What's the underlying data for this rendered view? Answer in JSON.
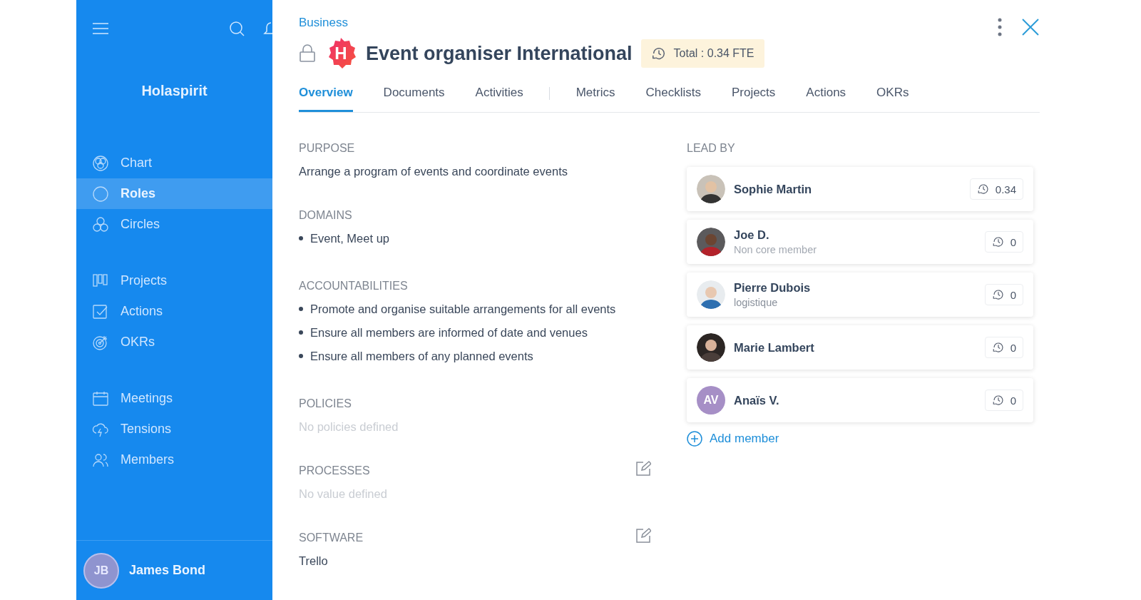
{
  "sidebar": {
    "brand": "Holaspirit",
    "nav_groups": [
      [
        {
          "label": "Chart",
          "selected": false
        },
        {
          "label": "Roles",
          "selected": true
        },
        {
          "label": "Circles",
          "selected": false
        }
      ],
      [
        {
          "label": "Projects",
          "selected": false
        },
        {
          "label": "Actions",
          "selected": false
        },
        {
          "label": "OKRs",
          "selected": false
        }
      ],
      [
        {
          "label": "Meetings",
          "selected": false
        },
        {
          "label": "Tensions",
          "selected": false
        },
        {
          "label": "Members",
          "selected": false
        }
      ]
    ],
    "user": {
      "initials": "JB",
      "name": "James Bond"
    }
  },
  "header": {
    "breadcrumb": "Business",
    "logo_letter": "H",
    "title": "Event organiser International",
    "badge": "Total : 0.34 FTE"
  },
  "tab_groups": [
    [
      {
        "label": "Overview",
        "selected": true
      },
      {
        "label": "Documents",
        "selected": false
      },
      {
        "label": "Activities",
        "selected": false
      }
    ],
    [
      {
        "label": "Metrics",
        "selected": false
      },
      {
        "label": "Checklists",
        "selected": false
      },
      {
        "label": "Projects",
        "selected": false
      },
      {
        "label": "Actions",
        "selected": false
      },
      {
        "label": "OKRs",
        "selected": false
      }
    ]
  ],
  "sections": [
    {
      "title": "PURPOSE",
      "kind": "text",
      "text": "Arrange a program of events and coordinate events",
      "editable": false
    },
    {
      "title": "DOMAINS",
      "kind": "bullets",
      "items": [
        "Event, Meet up"
      ],
      "editable": false
    },
    {
      "title": "ACCOUNTABILITIES",
      "kind": "bullets",
      "items": [
        "Promote and organise suitable arrangements for all events",
        "Ensure all members are informed of date and venues",
        "Ensure all members of any planned events"
      ],
      "editable": false
    },
    {
      "title": "POLICIES",
      "kind": "empty",
      "text": "No policies defined",
      "editable": false
    },
    {
      "title": "PROCESSES",
      "kind": "empty",
      "text": "No value defined",
      "editable": true
    },
    {
      "title": "SOFTWARE",
      "kind": "text",
      "text": "Trello",
      "editable": true
    }
  ],
  "lead_by": {
    "title": "LEAD BY",
    "members": [
      {
        "name": "Sophie Martin",
        "fte": "0.34"
      },
      {
        "name": "Joe D.",
        "subtitle": "Non core member",
        "subtitle_muted": true,
        "fte": "0"
      },
      {
        "name": "Pierre Dubois",
        "subtitle": "logistique",
        "subtitle_muted": false,
        "fte": "0"
      },
      {
        "name": "Marie Lambert",
        "fte": "0"
      },
      {
        "name": "Anaïs V.",
        "avatar": {
          "kind": "initials",
          "initials": "AV",
          "color": "#a68fc6"
        },
        "fte": "0"
      }
    ],
    "add_label": "Add member"
  }
}
